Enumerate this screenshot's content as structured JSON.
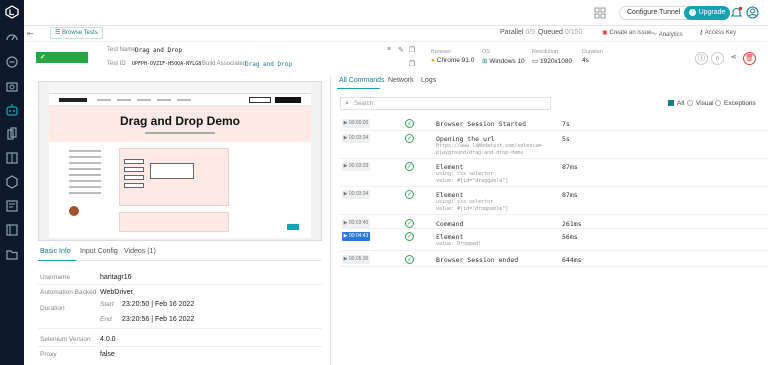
{
  "topbar": {
    "configure_tunnel": "Configure Tunnel",
    "tunnel_help": "?",
    "upgrade": "Upgrade",
    "upgrade_icon": "↑"
  },
  "header": {
    "browse_tests": "Browse Tests",
    "parallel_label": "Parallel",
    "parallel_value": "0/5",
    "queued_label": "Queued",
    "queued_value": "0/150",
    "create_issue": "Create an issue",
    "analytics": "Analytics",
    "access_key": "Access Key"
  },
  "test": {
    "status": "COMPLETED",
    "name_label": "Test Name",
    "name": "Drag and Drop",
    "id_label": "Test ID",
    "id": "UPFPH-OVZIF-H5OOA-NYLG8",
    "build_label": "Build Associated",
    "build": "Drag and Drop",
    "browser_label": "Browser",
    "browser": "Chrome 91.0",
    "os_label": "OS",
    "os": "Windows 10",
    "resolution_label": "Resolution",
    "resolution": "1920x1080",
    "duration_label": "Duration",
    "duration": "4s"
  },
  "preview": {
    "title": "Drag and Drop Demo"
  },
  "left_tabs": [
    "Basic Info",
    "Input Config",
    "Videos (1)"
  ],
  "basic_info": {
    "username_label": "Username",
    "username": "haritagr16",
    "automation_label": "Automation Backed",
    "automation": "WebDriver",
    "duration_label": "Duration",
    "start_label": "Start",
    "start": "23:20:50 | Feb 16 2022",
    "end_label": "End",
    "end": "23:20:56 | Feb 16 2022",
    "selenium_label": "Selenium Version",
    "selenium": "4.0.0",
    "proxy_label": "Proxy",
    "proxy": "false"
  },
  "right_tabs": [
    "All Commands",
    "Network",
    "Logs"
  ],
  "search": {
    "placeholder": "Search"
  },
  "filters": {
    "all": "All",
    "visual": "Visual",
    "exceptions": "Exceptions"
  },
  "commands": [
    {
      "ts": "▶ 00:00:00",
      "cmd": "Browser Session Started",
      "sub": [],
      "dur": "7s",
      "selected": false
    },
    {
      "ts": "▶ 00:03:34",
      "cmd": "Opening the url",
      "sub": [
        "https://www.lambdatest.com/selenium-",
        "playground/drag-and-drop-demo"
      ],
      "dur": "5s",
      "selected": false
    },
    {
      "ts": "▶ 00:03:33",
      "cmd": "Element",
      "sub": [
        "using: css selector",
        "value: #[id=\"draggable\"]"
      ],
      "dur": "87ms",
      "selected": false
    },
    {
      "ts": "▶ 00:03:34",
      "cmd": "Element",
      "sub": [
        "using: css selector",
        "value: #[id=\"droppable\"]"
      ],
      "dur": "87ms",
      "selected": false
    },
    {
      "ts": "▶ 00:03:40",
      "cmd": "Command",
      "sub": [],
      "dur": "261ms",
      "selected": false
    },
    {
      "ts": "▶ 00:04:43",
      "cmd": "Element",
      "sub": [
        "value: Dropped!"
      ],
      "dur": "56ms",
      "selected": true
    },
    {
      "ts": "▶ 00:05:36",
      "cmd": "Browser Session ended",
      "sub": [],
      "dur": "644ms",
      "selected": false
    }
  ]
}
